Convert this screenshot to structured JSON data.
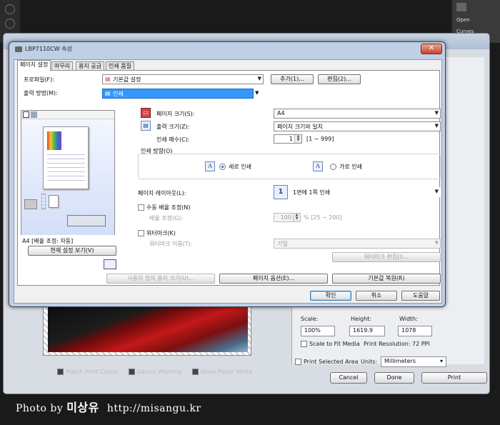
{
  "photoshop": {
    "panel_items": [
      "Open",
      "Curves"
    ],
    "right": {
      "scale_label": "Scale:",
      "height_label": "Height:",
      "width_label": "Width:",
      "scale_value": "100%",
      "height_value": "1619.9",
      "width_value": "1078",
      "fit_media_label": "Scale to Fit Media",
      "print_resolution": "Print Resolution: 72 PPI",
      "print_selected_area": "Print Selected Area",
      "units_label": "Units:",
      "units_value": "Millimeters",
      "cancel": "Cancel",
      "done": "Done",
      "print": "Print"
    },
    "bottom": {
      "match_print_colors": "Match Print Colors",
      "gamut_warning": "Gamut Warning",
      "show_paper_white": "Show Paper White"
    }
  },
  "watermark": {
    "prefix": "Photo by",
    "name": "미상유",
    "url": "http://misangu.kr"
  },
  "dialog": {
    "title": "LBP7110CW 속성",
    "close": "✕",
    "tabs": [
      "페이지 설정",
      "마무리",
      "용지 공급",
      "인쇄 품질"
    ],
    "profile_label": "프로파일(F):",
    "profile_value": "기본값 설정",
    "add_button": "추가(1)...",
    "edit_button": "편집(2)...",
    "output_label": "출력 방법(M):",
    "output_value": "인쇄",
    "page_size_label": "페이지 크기(S):",
    "page_size_value": "A4",
    "output_size_label": "출력 크기(Z):",
    "output_size_value": "페이지 크기와 일치",
    "copies_label": "인쇄 매수(C):",
    "copies_value": "1",
    "copies_range": "[1 ~ 999]",
    "orientation_label": "인쇄 방향(O)",
    "portrait_label": "세로 인쇄",
    "landscape_label": "가로 인쇄",
    "layout_label": "페이지 레이아웃(L):",
    "layout_value": "1면에 1쪽 인쇄",
    "layout_number": "1",
    "manual_scale_label": "수동 배율 조정(N)",
    "scale_label": "배율 조정(G):",
    "scale_value": "100",
    "scale_range": "% [25 ~ 200]",
    "watermark_label": "워터마크(K)",
    "watermark_name_label": "워터마크 이름(T):",
    "watermark_name_value": "기밀",
    "watermark_edit": "워터마크 편집(I)...",
    "preview_caption": "A4 [배율 조정: 자동]",
    "view_settings": "현재 설정 보기(V)",
    "custom_paper": "사용자 정의 용지 크기(U)...",
    "page_options": "페이지 옵션(E)...",
    "restore_defaults": "기본값 복원(R)",
    "ok": "확인",
    "cancel": "취소",
    "help": "도움말"
  }
}
